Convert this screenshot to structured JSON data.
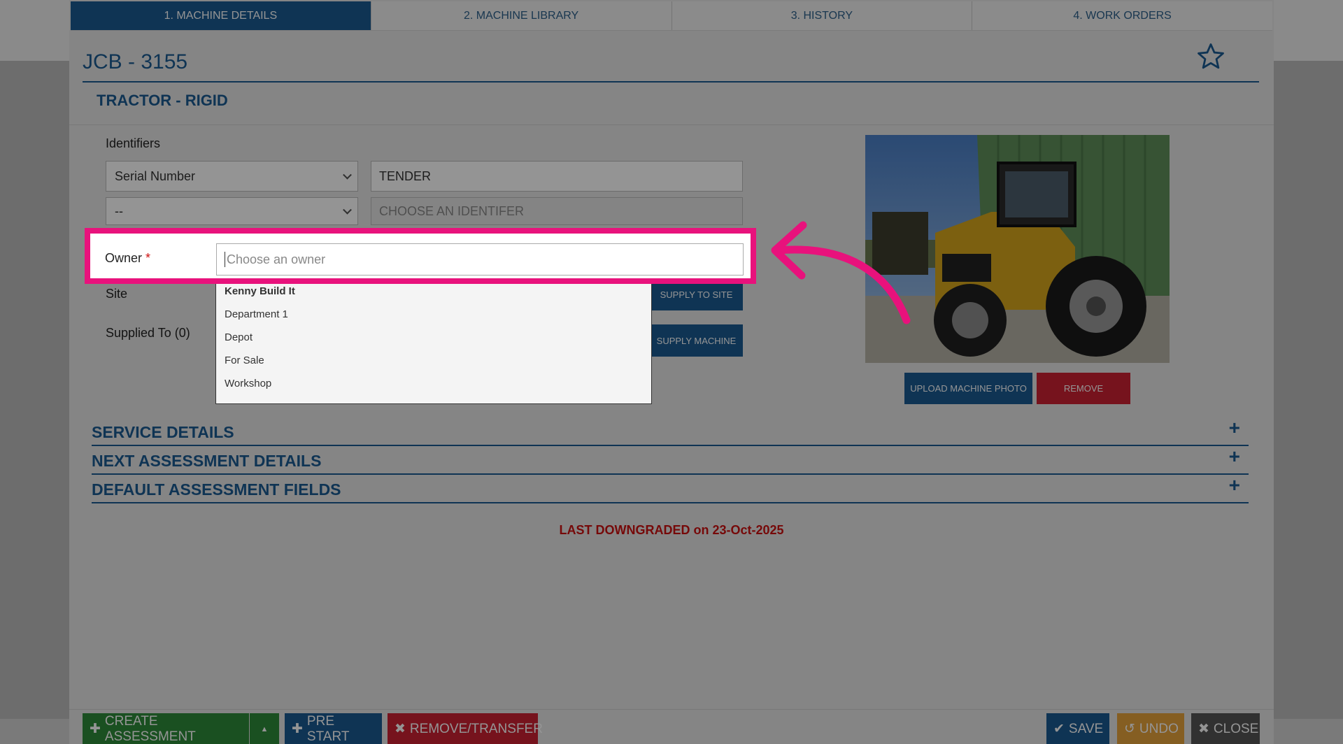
{
  "tabs": [
    {
      "label": "1. MACHINE DETAILS"
    },
    {
      "label": "2. MACHINE LIBRARY"
    },
    {
      "label": "3. HISTORY"
    },
    {
      "label": "4. WORK ORDERS"
    }
  ],
  "machine": {
    "title": "JCB - 3155",
    "type": "TRACTOR - RIGID"
  },
  "identifiers": {
    "label": "Identifiers",
    "row1": {
      "select": "Serial Number",
      "value": "TENDER"
    },
    "row2": {
      "select": "--",
      "placeholder": "CHOOSE AN IDENTIFER"
    }
  },
  "owner": {
    "label": "Owner",
    "required_mark": "*",
    "placeholder": "Choose an owner"
  },
  "owner_options": [
    "Kenny Build It",
    "Department 1",
    "Depot",
    "For Sale",
    "Workshop"
  ],
  "site": {
    "label": "Site",
    "button": "SUPPLY TO SITE"
  },
  "supplied": {
    "label": "Supplied To (0)",
    "button": "SUPPLY MACHINE"
  },
  "photo": {
    "upload_button": "UPLOAD MACHINE PHOTO",
    "remove_button": "REMOVE"
  },
  "sections": [
    {
      "title": "SERVICE DETAILS",
      "icon": "+"
    },
    {
      "title": "NEXT ASSESSMENT DETAILS",
      "icon": "+"
    },
    {
      "title": "DEFAULT ASSESSMENT FIELDS",
      "icon": "+"
    }
  ],
  "downgrade_text": "LAST DOWNGRADED on 23-Oct-2025",
  "footer": {
    "create": "CREATE ASSESSMENT",
    "pre_start": "PRE START",
    "remove_transfer": "REMOVE/TRANSFER",
    "save": "SAVE",
    "undo": "UNDO",
    "close": "CLOSE"
  },
  "colors": {
    "brand": "#1b5b92",
    "danger": "#cc2233",
    "success": "#2e8b3a",
    "highlight": "#e8127c",
    "undo": "#e6a23c"
  }
}
